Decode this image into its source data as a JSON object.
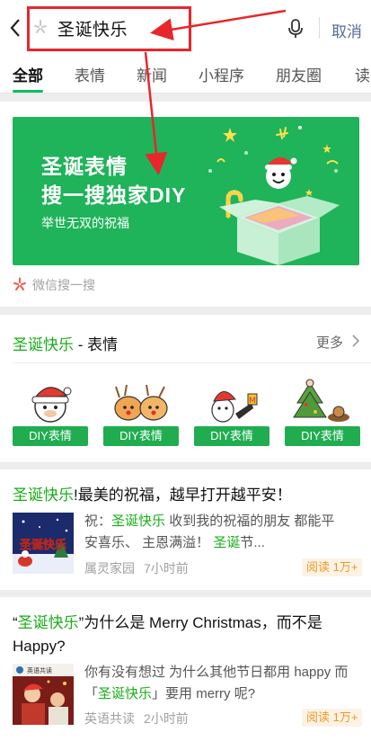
{
  "search": {
    "query": "圣诞快乐",
    "cancel_label": "取消"
  },
  "tabs": [
    {
      "label": "全部"
    },
    {
      "label": "表情"
    },
    {
      "label": "新闻"
    },
    {
      "label": "小程序"
    },
    {
      "label": "朋友圈"
    },
    {
      "label": "读"
    }
  ],
  "banner": {
    "line1": "圣诞表情",
    "line2": "搜一搜独家DIY",
    "subtitle": "举世无双的祝福",
    "source": "微信搜一搜"
  },
  "sticker_section": {
    "title_highlight": "圣诞快乐",
    "title_rest": " - 表情",
    "more_label": "更多",
    "stickers": [
      {
        "label": "DIY表情"
      },
      {
        "label": "DIY表情"
      },
      {
        "label": "DIY表情"
      },
      {
        "label": "DIY表情"
      }
    ]
  },
  "articles": [
    {
      "title_highlight": "圣诞快乐",
      "title_rest": "!最美的祝福，越早打开越平安！",
      "thumb_text": "圣诞快乐",
      "snippet_line1_prefix": "祝：",
      "snippet_line1_highlight": "圣诞快乐",
      "snippet_line1_suffix": " 收到我的祝福的朋友 都能平",
      "snippet_line2_prefix": "安喜乐、 主恩满溢！ ",
      "snippet_line2_highlight": "圣诞",
      "snippet_line2_suffix": "节...",
      "source": "属灵家园",
      "time": "7小时前",
      "reads": "阅读 1万+"
    },
    {
      "title_open": "“",
      "title_highlight": "圣诞快乐",
      "title_rest": "”为什么是 Merry Christmas，而不是",
      "title_line2": "Happy?",
      "thumb_text": "英语共读",
      "snippet_line1": "你有没有想过 为什么其他节日都用 happy 而",
      "snippet_line2_prefix": "「",
      "snippet_line2_highlight": "圣诞快乐",
      "snippet_line2_suffix": "」要用 merry 呢?",
      "source": "英语共读",
      "time": "2小时前",
      "reads": "阅读 1万+"
    }
  ],
  "colors": {
    "accent_green": "#1aad19",
    "banner_green": "#1fb35a",
    "annotation_red": "#e8262b",
    "link_blue": "#576b95"
  }
}
